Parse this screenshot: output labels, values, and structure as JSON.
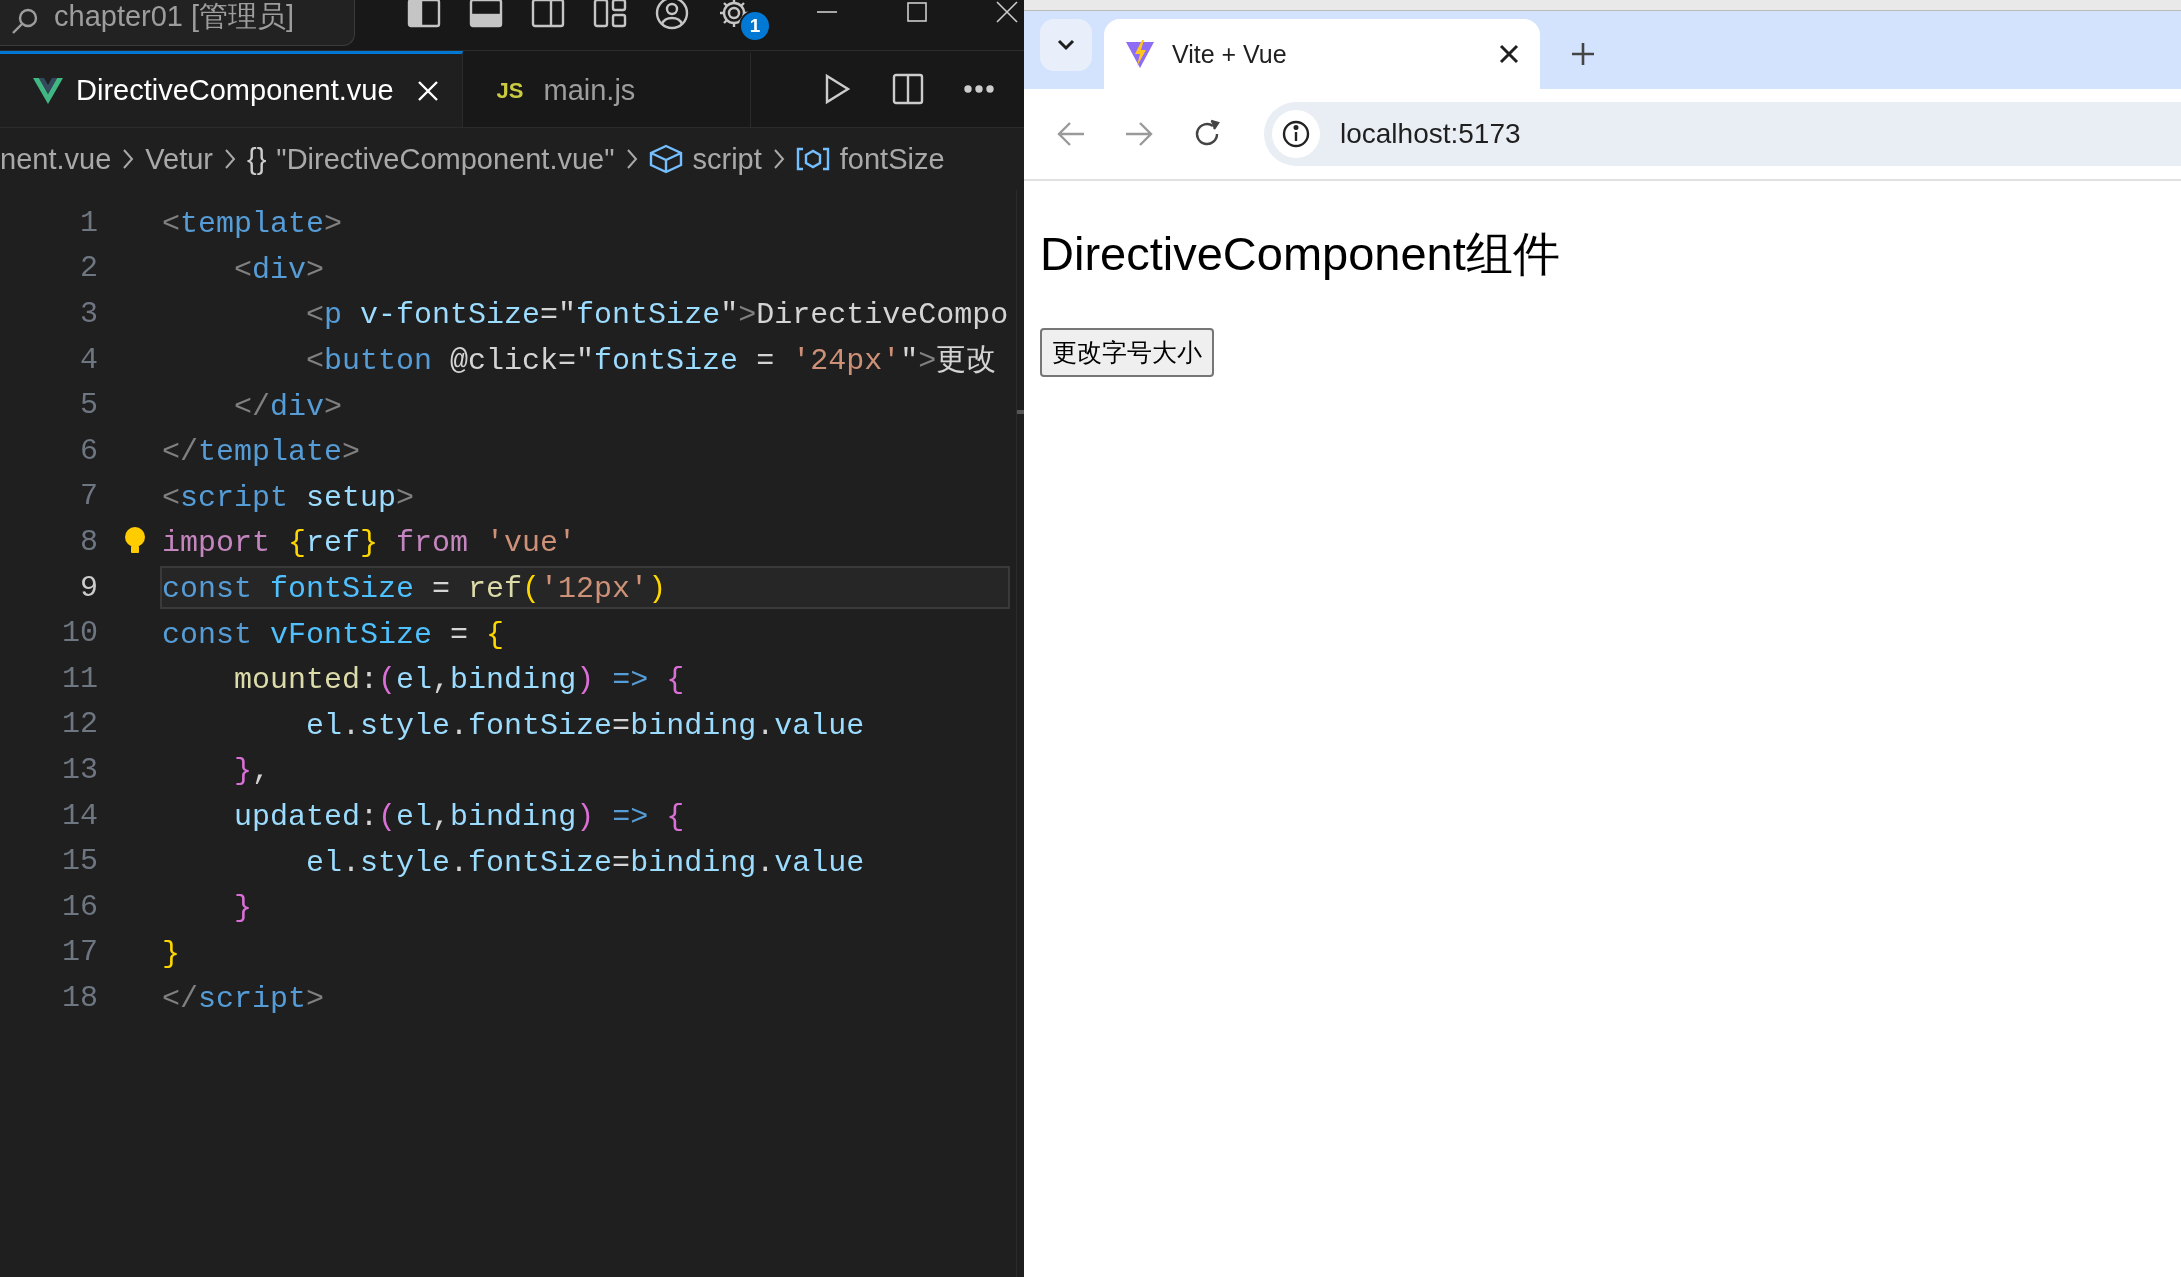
{
  "title_bar": {
    "search": "chapter01 [管理员]",
    "notification_badge": "1"
  },
  "editor_tabs": [
    {
      "kind": "vue",
      "label": "DirectiveComponent.vue",
      "selected": true
    },
    {
      "kind": "js",
      "badge": "JS",
      "label": "main.js",
      "selected": false
    }
  ],
  "breadcrumb": [
    {
      "kind": "file",
      "text": "nent.vue"
    },
    {
      "kind": "plain",
      "text": "Vetur"
    },
    {
      "kind": "braces",
      "icon": "{}",
      "text": "\"DirectiveComponent.vue\""
    },
    {
      "kind": "module",
      "text": "script"
    },
    {
      "kind": "field",
      "text": "fontSize"
    }
  ],
  "code": {
    "lines": [
      {
        "number": "1",
        "current": false,
        "tokens": [
          {
            "kind": "punct",
            "text": "<"
          },
          {
            "kind": "tag",
            "text": "template"
          },
          {
            "kind": "punct",
            "text": ">"
          }
        ]
      },
      {
        "number": "2",
        "current": false,
        "tokens": [
          {
            "kind": "punct",
            "text": "    <"
          },
          {
            "kind": "tag",
            "text": "div"
          },
          {
            "kind": "punct",
            "text": ">"
          }
        ]
      },
      {
        "number": "3",
        "current": false,
        "tokens": [
          {
            "kind": "punct",
            "text": "        <"
          },
          {
            "kind": "tag",
            "text": "p"
          },
          {
            "kind": "var",
            "text": " v-fontSize"
          },
          {
            "kind": "text",
            "text": "=\""
          },
          {
            "kind": "var",
            "text": "fontSize"
          },
          {
            "kind": "text",
            "text": "\""
          },
          {
            "kind": "punct",
            "text": ">"
          },
          {
            "kind": "text",
            "text": "DirectiveCompo"
          }
        ]
      },
      {
        "number": "4",
        "current": false,
        "tokens": [
          {
            "kind": "punct",
            "text": "        <"
          },
          {
            "kind": "tag",
            "text": "button"
          },
          {
            "kind": "text",
            "text": " @click=\""
          },
          {
            "kind": "var",
            "text": "fontSize"
          },
          {
            "kind": "text",
            "text": " = "
          },
          {
            "kind": "string",
            "text": "'24px'"
          },
          {
            "kind": "text",
            "text": "\""
          },
          {
            "kind": "punct",
            "text": ">"
          },
          {
            "kind": "text",
            "text": "更改"
          }
        ]
      },
      {
        "number": "5",
        "current": false,
        "tokens": [
          {
            "kind": "punct",
            "text": "    </"
          },
          {
            "kind": "tag",
            "text": "div"
          },
          {
            "kind": "punct",
            "text": ">"
          }
        ]
      },
      {
        "number": "6",
        "current": false,
        "tokens": [
          {
            "kind": "punct",
            "text": "</"
          },
          {
            "kind": "tag",
            "text": "template"
          },
          {
            "kind": "punct",
            "text": ">"
          }
        ]
      },
      {
        "number": "7",
        "current": false,
        "tokens": [
          {
            "kind": "punct",
            "text": "<"
          },
          {
            "kind": "tag",
            "text": "script"
          },
          {
            "kind": "var",
            "text": " setup"
          },
          {
            "kind": "punct",
            "text": ">"
          }
        ]
      },
      {
        "number": "8",
        "current": false,
        "lightbulb": true,
        "tokens": [
          {
            "kind": "control",
            "text": "import"
          },
          {
            "kind": "brace1",
            "text": " {"
          },
          {
            "kind": "var",
            "text": "ref"
          },
          {
            "kind": "brace1",
            "text": "}"
          },
          {
            "kind": "control",
            "text": " from"
          },
          {
            "kind": "string",
            "text": " 'vue'"
          }
        ]
      },
      {
        "number": "9",
        "current": true,
        "tokens": [
          {
            "kind": "keyword",
            "text": "const"
          },
          {
            "kind": "const",
            "text": " fontSize"
          },
          {
            "kind": "text",
            "text": " = "
          },
          {
            "kind": "func",
            "text": "ref"
          },
          {
            "kind": "brace1",
            "text": "("
          },
          {
            "kind": "string",
            "text": "'12px'"
          },
          {
            "kind": "brace1",
            "text": ")"
          }
        ]
      },
      {
        "number": "10",
        "current": false,
        "tokens": [
          {
            "kind": "keyword",
            "text": "const"
          },
          {
            "kind": "const",
            "text": " vFontSize"
          },
          {
            "kind": "text",
            "text": " = "
          },
          {
            "kind": "brace1",
            "text": "{"
          }
        ]
      },
      {
        "number": "11",
        "current": false,
        "tokens": [
          {
            "kind": "func",
            "text": "    mounted"
          },
          {
            "kind": "text",
            "text": ":"
          },
          {
            "kind": "brace2",
            "text": "("
          },
          {
            "kind": "var",
            "text": "el"
          },
          {
            "kind": "text",
            "text": ","
          },
          {
            "kind": "var",
            "text": "binding"
          },
          {
            "kind": "brace2",
            "text": ")"
          },
          {
            "kind": "keyword",
            "text": " =>"
          },
          {
            "kind": "brace2",
            "text": " {"
          }
        ]
      },
      {
        "number": "12",
        "current": false,
        "tokens": [
          {
            "kind": "var",
            "text": "        el"
          },
          {
            "kind": "text",
            "text": "."
          },
          {
            "kind": "var",
            "text": "style"
          },
          {
            "kind": "text",
            "text": "."
          },
          {
            "kind": "var",
            "text": "fontSize"
          },
          {
            "kind": "text",
            "text": "="
          },
          {
            "kind": "var",
            "text": "binding"
          },
          {
            "kind": "text",
            "text": "."
          },
          {
            "kind": "var",
            "text": "value"
          }
        ]
      },
      {
        "number": "13",
        "current": false,
        "tokens": [
          {
            "kind": "brace2",
            "text": "    }"
          },
          {
            "kind": "text",
            "text": ","
          }
        ]
      },
      {
        "number": "14",
        "current": false,
        "tokens": [
          {
            "kind": "var",
            "text": "    updated"
          },
          {
            "kind": "text",
            "text": ":"
          },
          {
            "kind": "brace2",
            "text": "("
          },
          {
            "kind": "var",
            "text": "el"
          },
          {
            "kind": "text",
            "text": ","
          },
          {
            "kind": "var",
            "text": "binding"
          },
          {
            "kind": "brace2",
            "text": ")"
          },
          {
            "kind": "keyword",
            "text": " =>"
          },
          {
            "kind": "brace2",
            "text": " {"
          }
        ]
      },
      {
        "number": "15",
        "current": false,
        "tokens": [
          {
            "kind": "var",
            "text": "        el"
          },
          {
            "kind": "text",
            "text": "."
          },
          {
            "kind": "var",
            "text": "style"
          },
          {
            "kind": "text",
            "text": "."
          },
          {
            "kind": "var",
            "text": "fontSize"
          },
          {
            "kind": "text",
            "text": "="
          },
          {
            "kind": "var",
            "text": "binding"
          },
          {
            "kind": "text",
            "text": "."
          },
          {
            "kind": "var",
            "text": "value"
          }
        ]
      },
      {
        "number": "16",
        "current": false,
        "tokens": [
          {
            "kind": "brace2",
            "text": "    }"
          }
        ]
      },
      {
        "number": "17",
        "current": false,
        "tokens": [
          {
            "kind": "brace1",
            "text": "}"
          }
        ]
      },
      {
        "number": "18",
        "current": false,
        "tokens": [
          {
            "kind": "punct",
            "text": "</"
          },
          {
            "kind": "tag",
            "text": "script"
          },
          {
            "kind": "punct",
            "text": ">"
          }
        ]
      }
    ]
  },
  "browser": {
    "tabs": [
      {
        "title": "Vite + Vue",
        "selected": true
      }
    ],
    "address": "localhost:5173",
    "page": {
      "heading": "DirectiveComponent组件",
      "button": "更改字号大小"
    }
  }
}
